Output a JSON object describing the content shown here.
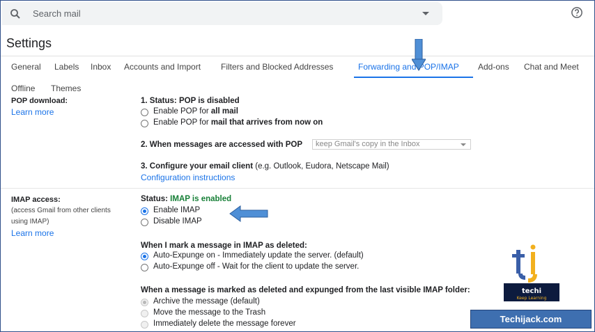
{
  "search": {
    "placeholder": "Search mail"
  },
  "page": {
    "title": "Settings"
  },
  "tabs": [
    "General",
    "Labels",
    "Inbox",
    "Accounts and Import",
    "Filters and Blocked Addresses",
    "Forwarding and POP/IMAP",
    "Add-ons",
    "Chat and Meet",
    "Offline",
    "Themes"
  ],
  "active_tab": "Forwarding and POP/IMAP",
  "pop": {
    "label": "POP download:",
    "learn_more": "Learn more",
    "status_prefix": "1. Status: POP is disabled",
    "opt1_prefix": "Enable POP for ",
    "opt1_bold": "all mail",
    "opt2_prefix": "Enable POP for ",
    "opt2_bold": "mail that arrives from now on",
    "q2": "2. When messages are accessed with POP",
    "q2_select": "keep Gmail's copy in the Inbox",
    "q3_bold": "3. Configure your email client",
    "q3_rest": " (e.g. Outlook, Eudora, Netscape Mail)",
    "config_link": "Configuration instructions"
  },
  "imap": {
    "label": "IMAP access:",
    "sub1": "(access Gmail from other clients",
    "sub2": "using IMAP)",
    "learn_more": "Learn more",
    "status_prefix": "Status: ",
    "status_value": "IMAP is enabled",
    "enable": "Enable IMAP",
    "disable": "Disable IMAP",
    "deleted_heading": "When I mark a message in IMAP as deleted:",
    "auto_on": "Auto-Expunge on - Immediately update the server. (default)",
    "auto_off": "Auto-Expunge off - Wait for the client to update the server.",
    "expunged_heading": "When a message is marked as deleted and expunged from the last visible IMAP folder:",
    "archive": "Archive the message (default)",
    "trash": "Move the message to the Trash",
    "delete": "Immediately delete the message forever"
  },
  "brand": {
    "logo_name": "techi jack",
    "logo_tagline": "Keep Learning",
    "site": "Techijack.com"
  },
  "colors": {
    "accent": "#1a73e8",
    "enabled_green": "#188038",
    "brand_blue": "#3e6fb0",
    "arrow_blue": "#4f8fd6"
  }
}
